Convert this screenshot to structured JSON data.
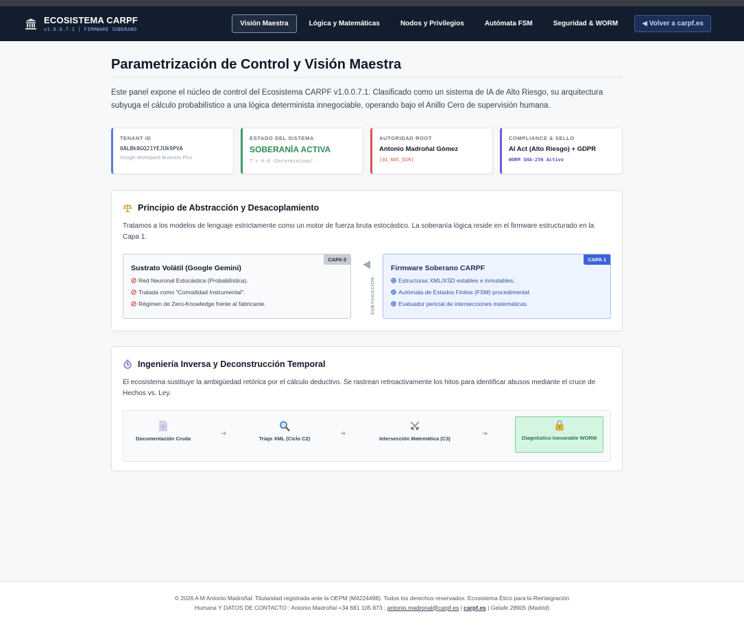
{
  "nav": {
    "brand_title": "ECOSISTEMA CARPF",
    "brand_sub": "v1.0.0.7.1 | FIRMWARE SOBERANO",
    "links": [
      {
        "label": "Visión Maestra"
      },
      {
        "label": "Lógica y Matemáticas"
      },
      {
        "label": "Nodos y Privilegios"
      },
      {
        "label": "Autómata FSM"
      },
      {
        "label": "Seguridad & WORM"
      }
    ],
    "back_label": "◀ Volver a carpf.es"
  },
  "page": {
    "title": "Parametrización de Control y Visión Maestra",
    "intro": "Este panel expone el núcleo de control del Ecosistema CARPF v1.0.0.7.1. Clasificado como un sistema de IA de Alto Riesgo, su arquitectura subyuga el cálculo probabilístico a una lógica determinista innegociable, operando bajo el Anillo Cero de supervisión humana."
  },
  "cards": [
    {
      "label": "TENANT ID",
      "value": "0ALBk0GQ21YEJUk9PVA",
      "sub": "Google Workspace Business Plus"
    },
    {
      "label": "ESTADO DEL SISTEMA",
      "value": "SOBERANÍA ACTIVA",
      "sub": "T = 0.0 (Determinismo)"
    },
    {
      "label": "AUTORIDAD ROOT",
      "value": "Antonio Madroñal Gómez",
      "sub": "[01_NUC_DIR]"
    },
    {
      "label": "COMPLIANCE & SELLO",
      "value": "AI Act (Alto Riesgo) + GDPR",
      "sub": "WORM SHA-256 Activo"
    }
  ],
  "abstraction": {
    "title": "Principio de Abstracción y Desacoplamiento",
    "text": "Tratamos a los modelos de lenguaje estrictamente como un motor de fuerza bruta estocástico. La soberanía lógica reside en el firmware estructurado en la Capa 1.",
    "layer0": {
      "badge": "CAPA 0",
      "title": "Sustrato Volátil (Google Gemini)",
      "items": [
        "Red Neuronal Estocástica (Probabilística).",
        "Tratada como \"Comodidad Instrumental\".",
        "Régimen de Zero-Knowledge frente al fabricante."
      ]
    },
    "between_label": "SUBYUGACIÓN",
    "layer1": {
      "badge": "CAPA 1",
      "title": "Firmware Soberano CARPF",
      "items": [
        "Estructuras XML/XSD estables e inmutables.",
        "Autómata de Estados Finitos (FSM) procedimental.",
        "Evaluador pericial de intersecciones matemáticas."
      ]
    }
  },
  "reverse": {
    "title": "Ingeniería Inversa y Deconstrucción Temporal",
    "text": "El ecosistema sustituye la ambigüedad retórica por el cálculo deductivo. Se rastrean retroactivamente los hitos para identificar abusos mediante el cruce de Hechos vs. Ley.",
    "steps": [
      {
        "label": "Documentación Cruda",
        "icon": "document-icon"
      },
      {
        "label": "Triaje XML (Ciclo C2)",
        "icon": "magnifier-icon"
      },
      {
        "label": "Intersección Matemática (C3)",
        "icon": "crossed-swords-icon"
      },
      {
        "label": "Diagnóstico Inexorable WORM",
        "icon": "lock-icon"
      }
    ],
    "arrow": "➔"
  },
  "footer": {
    "line1": "© 2026 A M Antonio Madroñal. Titularidad registrada ante la OEPM (M4224498). Todos los derechos reservados. Ecosistema Ético para la Reintegración Humana Y DATOS DE CONTACTO : Antonio Madroñal +34 681 105 873 ;",
    "email": "antonio.madronal@carpf.es",
    "sep1": " | ",
    "site": "carpf.es",
    "tail": " | Getafe 28905 (Madrid)"
  },
  "colors": {
    "nav_bg": "#121d2e",
    "accent_blue": "#3b63d9",
    "status_green": "#2e8b57",
    "root_red": "#d9534f",
    "worm_purple": "#5a4fc9"
  }
}
